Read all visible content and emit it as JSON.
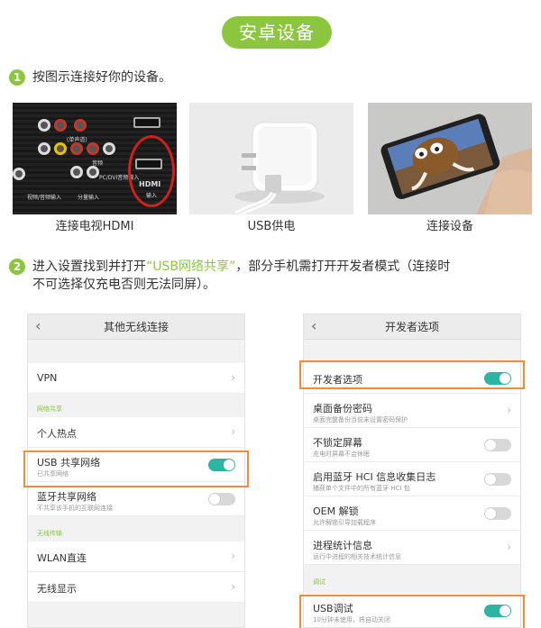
{
  "title": "安卓设备",
  "steps": [
    {
      "num": "1",
      "text": "按图示连接好你的设备。"
    },
    {
      "num": "2",
      "text_before": "进入设置找到并打开",
      "highlight": "“USB网络共享”",
      "text_after": "，部分手机需打开开发者模式（连接时",
      "line2": "不可选择仅充电否则无法同屏）。"
    }
  ],
  "photos": [
    {
      "caption": "连接电视HDMI",
      "tv_labels": {
        "hdmi": "HDMI",
        "input": "输入",
        "l1": "视频/音频输入",
        "l2": "分量输入",
        "l3": "(单声道)",
        "l4": "音频",
        "l5": "PC/DVI音频输入"
      }
    },
    {
      "caption": "USB供电"
    },
    {
      "caption": "连接设备"
    }
  ],
  "left_screen": {
    "back": "‹",
    "header": "其他无线连接",
    "vpn": "VPN",
    "section_share": "网络共享",
    "hotspot": "个人热点",
    "usb_share": "USB 共享网络",
    "usb_share_sub": "已共享网络",
    "usb_share_on": true,
    "bt_share": "蓝牙共享网络",
    "bt_share_sub": "不共享该手机的互联网连接",
    "bt_share_on": false,
    "section_wireless": "无线传输",
    "wlan_direct": "WLAN直连",
    "wireless_display": "无线显示"
  },
  "right_screen": {
    "back": "‹",
    "header": "开发者选项",
    "dev_options": "开发者选项",
    "dev_options_on": true,
    "backup_pwd": "桌面备份密码",
    "backup_pwd_sub": "桌面完整备份当前未设置密码保护",
    "stay_awake": "不锁定屏幕",
    "stay_awake_sub": "充电时屏幕不会休眠",
    "stay_awake_on": false,
    "bt_hci": "启用蓝牙 HCI 信息收集日志",
    "bt_hci_sub": "捕获单个文件中的所有蓝牙 HCI 包",
    "bt_hci_on": false,
    "oem": "OEM 解锁",
    "oem_sub": "允许解锁引导加载程序",
    "oem_on": false,
    "proc_stats": "进程统计信息",
    "proc_stats_sub": "运行中进程的相关技术统计信息",
    "section_debug": "调试",
    "usb_debug": "USB调试",
    "usb_debug_sub": "10分钟未使用，将自动关闭",
    "usb_debug_on": true
  },
  "colors": {
    "accent": "#8cc63f",
    "toggle_on": "#2bb5a2",
    "highlight_box": "#f28c3b",
    "circle": "#d0201c"
  }
}
